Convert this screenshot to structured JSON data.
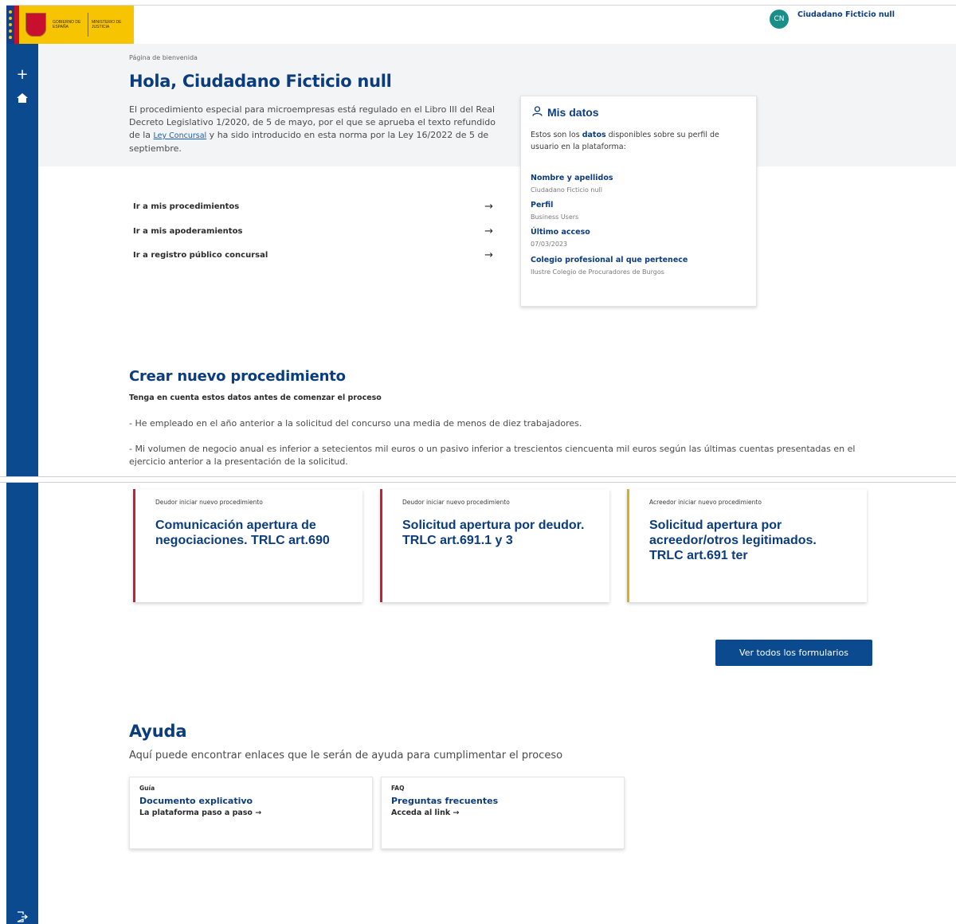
{
  "header": {
    "logo_left_text": "GOBIERNO DE ESPAÑA",
    "logo_right_text": "MINISTERIO DE JUSTICIA",
    "user_initials": "CN",
    "user_name": "Ciudadano Ficticio null"
  },
  "sidebar": {
    "add_icon": "plus-icon",
    "home_icon": "home-icon",
    "logout_icon": "logout-icon"
  },
  "hero": {
    "breadcrumb": "Página de bienvenida",
    "greeting": "Hola, Ciudadano Ficticio null",
    "intro_before_link": "El procedimiento especial para microempresas está regulado en el Libro III del Real Decreto Legislativo 1/2020, de 5 de mayo, por el que se aprueba el texto refundido de la ",
    "intro_link": "Ley Concursal",
    "intro_after_link": " y ha sido introducido en esta norma por la Ley 16/2022 de 5 de septiembre."
  },
  "quick_links": [
    {
      "label": "Ir a mis procedimientos",
      "arrow": "→"
    },
    {
      "label": "Ir a mis apoderamientos",
      "arrow": "→"
    },
    {
      "label": "Ir a registro público concursal",
      "arrow": "→"
    }
  ],
  "mis_datos": {
    "title": "Mis datos",
    "desc_before": "Estos son los ",
    "desc_bold": "datos",
    "desc_after": " disponibles sobre su perfil de usuario en la plataforma:",
    "fields": [
      {
        "label": "Nombre y apellidos",
        "value": "Ciudadano Ficticio null"
      },
      {
        "label": "Perfil",
        "value": "Business Users"
      },
      {
        "label": "Último acceso",
        "value": "07/03/2023"
      },
      {
        "label": "Colegio profesional al que pertenece",
        "value": "Ilustre Colegio de Procuradores de Burgos"
      }
    ]
  },
  "crear": {
    "title": "Crear nuevo procedimiento",
    "subtitle": "Tenga en cuenta estos datos antes de comenzar el proceso",
    "req1": "- He empleado en el año anterior a la solicitud del concurso una media de menos de diez trabajadores.",
    "req2": "- Mi volumen de negocio  anual es inferior a setecientos mil  euros o un pasivo inferior a trescientos ciencuenta mil  euros según las últimas cuentas presentadas en el ejercicio anterior a la presentación de la solicitud."
  },
  "proc_cards": [
    {
      "kind": "Deudor iniciar nuevo procedimiento",
      "title": "Comunicación apertura de negociaciones. TRLC art.690",
      "accent": "#c4203c"
    },
    {
      "kind": "Deudor iniciar nuevo procedimiento",
      "title": "Solicitud apertura por deudor. TRLC art.691.1 y 3",
      "accent": "#c4203c"
    },
    {
      "kind": "Acreedor iniciar nuevo procedimiento",
      "title": "Solicitud apertura por acreedor/otros legitimados. TRLC art.691 ter",
      "accent": "#d3b31e"
    }
  ],
  "ver_todos": "Ver todos los formularios",
  "ayuda": {
    "title": "Ayuda",
    "subtitle": "Aquí puede encontrar enlaces que le serán de ayuda para cumplimentar el proceso",
    "cards": [
      {
        "kind": "Guía",
        "title": "Documento explicativo",
        "link": "La plataforma paso a paso →"
      },
      {
        "kind": "FAQ",
        "title": "Preguntas frecuentes",
        "link": "Acceda al link →"
      }
    ]
  },
  "colors": {
    "primary": "#0b4a8f",
    "title": "#0b3d7e",
    "accent_red": "#c4203c",
    "accent_yellow": "#d3b31e",
    "avatar": "#1a8f8a",
    "logo_bg": "#f6c400"
  }
}
